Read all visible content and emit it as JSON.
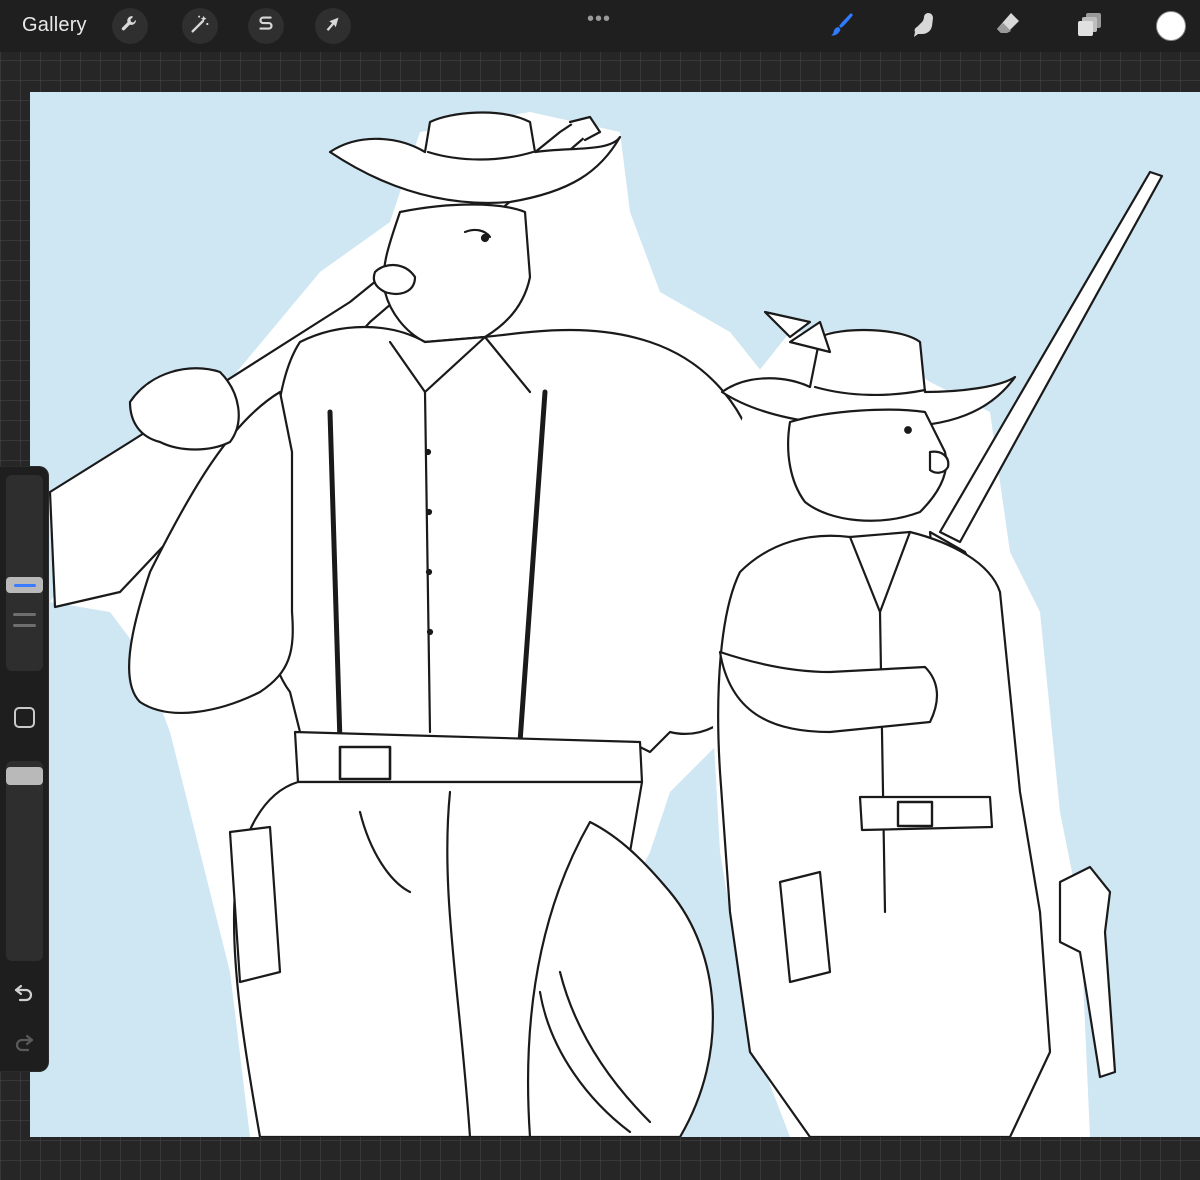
{
  "toolbar": {
    "gallery_label": "Gallery",
    "more_dots": "•••",
    "actions_icon": "wrench-icon",
    "adjustments_icon": "magic-wand-icon",
    "selection_icon": "selection-s-icon",
    "transform_icon": "arrow-cursor-icon",
    "brush_icon": "brush-icon",
    "smudge_icon": "smudge-finger-icon",
    "eraser_icon": "eraser-icon",
    "layers_icon": "layers-icon",
    "active_tool": "brush",
    "active_color": "#ffffff",
    "accent_color": "#2f7bff"
  },
  "sidebar": {
    "modify_icon": "square-icon",
    "undo_icon": "undo-arrow-icon",
    "redo_icon": "redo-arrow-icon"
  },
  "canvas": {
    "background_color": "#cfe6f3",
    "subject": "sketch-artwork"
  }
}
